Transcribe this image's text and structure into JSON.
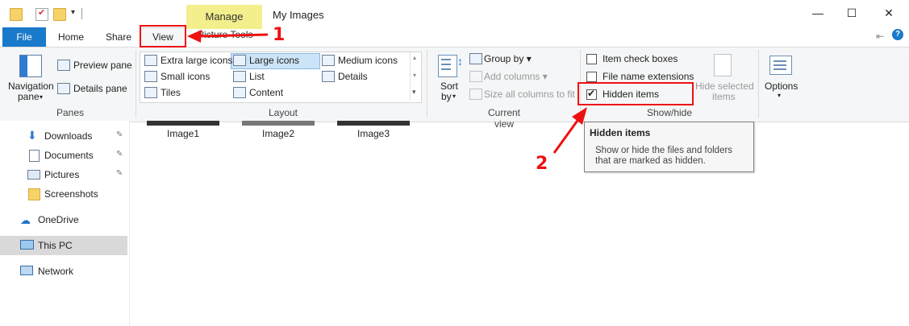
{
  "window": {
    "title": "My Images",
    "context_tab": "Manage",
    "context_group": "Picture Tools",
    "minimize": "—",
    "maximize": "☐",
    "close": "✕"
  },
  "tabs": {
    "file": "File",
    "home": "Home",
    "share": "Share",
    "view": "View"
  },
  "ribbon": {
    "panes": {
      "navigation_pane": "Navigation",
      "navigation_pane_2": "pane",
      "preview_pane": "Preview pane",
      "details_pane": "Details pane",
      "group": "Panes"
    },
    "layout": {
      "items": [
        "Extra large icons",
        "Large icons",
        "Medium icons",
        "Small icons",
        "List",
        "Details",
        "Tiles",
        "Content"
      ],
      "selected": "Large icons",
      "group": "Layout"
    },
    "current_view": {
      "sort_by": "Sort",
      "sort_by_2": "by",
      "group_by": "Group by",
      "add_columns": "Add columns",
      "size_columns": "Size all columns to fit",
      "group": "Current view"
    },
    "show_hide": {
      "item_checkboxes": "Item check boxes",
      "file_name_extensions": "File name extensions",
      "hidden_items": "Hidden items",
      "hide_selected": "Hide selected",
      "hide_selected_2": "items",
      "group": "Show/hide"
    },
    "options": "Options"
  },
  "nav": {
    "items": [
      "Downloads",
      "Documents",
      "Pictures",
      "Screenshots",
      "OneDrive",
      "This PC",
      "Network"
    ]
  },
  "files": [
    "Image1",
    "Image2",
    "Image3"
  ],
  "tooltip": {
    "title": "Hidden items",
    "body": "Show or hide the files and folders that are marked as hidden."
  },
  "annotations": {
    "step1": "1",
    "step2": "2"
  },
  "colors": {
    "file_tab": "#1979ca",
    "manage_tab": "#f2ef8c",
    "annotation": "#e11111"
  }
}
